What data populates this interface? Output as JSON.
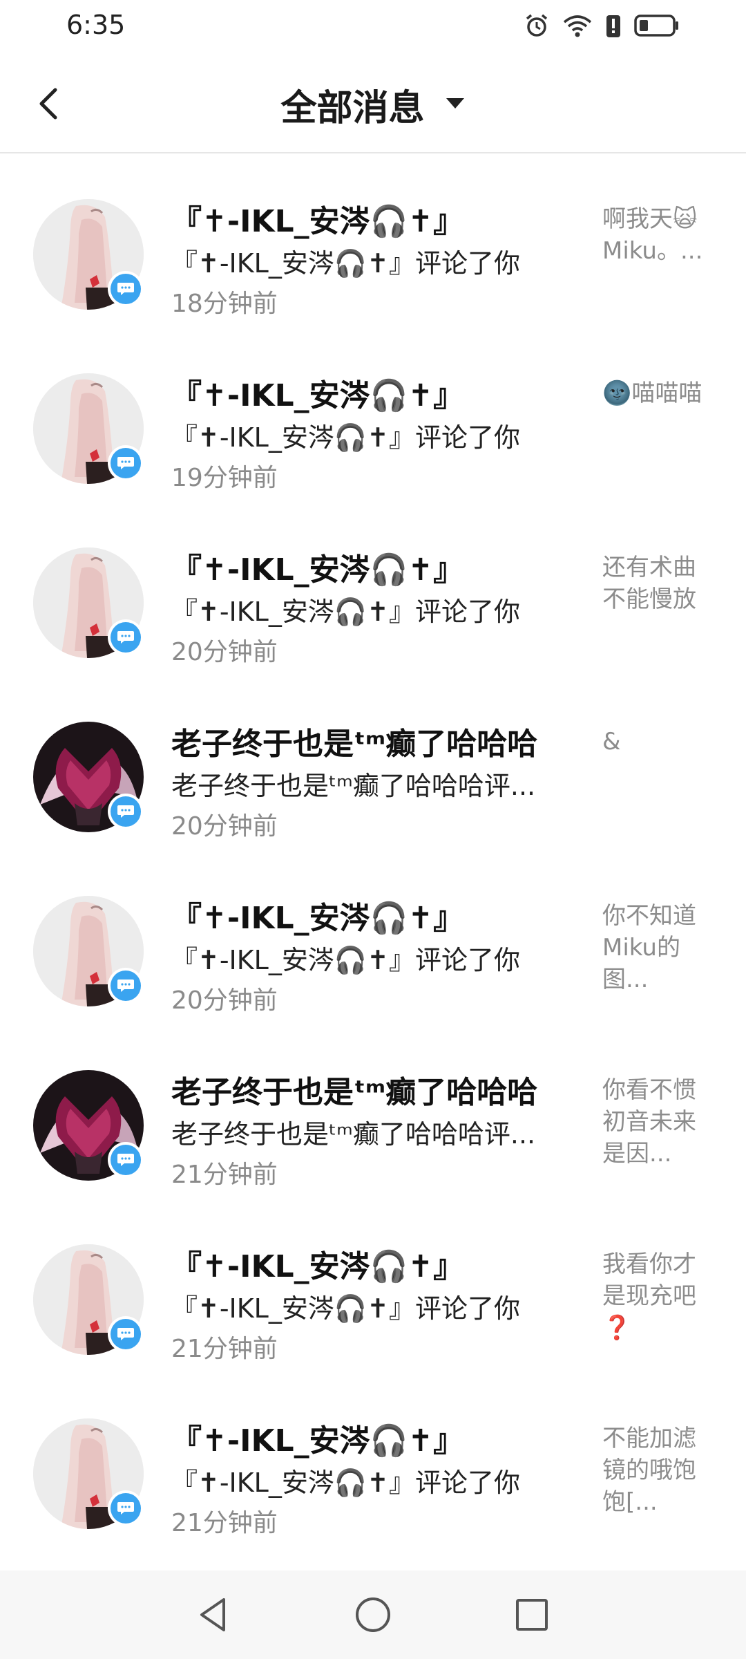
{
  "status_bar": {
    "time": "6:35",
    "icons": [
      "alarm-icon",
      "wifi-icon",
      "battery-alert-icon",
      "battery-icon"
    ]
  },
  "header": {
    "title": "全部消息",
    "back_icon": "chevron-left-icon",
    "dropdown_icon": "caret-down-icon"
  },
  "messages": [
    {
      "name": "『✝-IKL_安涔🎧✝』",
      "action": "『✝-IKL_安涔🎧✝』评论了你",
      "time": "18分钟前",
      "preview": "啊我天🙀 Miku。...",
      "avatar": "pink-hair-avatar"
    },
    {
      "name": "『✝-IKL_安涔🎧✝』",
      "action": "『✝-IKL_安涔🎧✝』评论了你",
      "time": "19分钟前",
      "preview": "🌚喵喵喵",
      "avatar": "pink-hair-avatar"
    },
    {
      "name": "『✝-IKL_安涔🎧✝』",
      "action": "『✝-IKL_安涔🎧✝』评论了你",
      "time": "20分钟前",
      "preview": "还有术曲不能慢放",
      "avatar": "pink-hair-avatar"
    },
    {
      "name": "老子终于也是ᵗᵐ癫了哈哈哈",
      "action": "老子终于也是ᵗᵐ癫了哈哈哈评...",
      "time": "20分钟前",
      "preview": "&",
      "avatar": "heart-mask-avatar"
    },
    {
      "name": "『✝-IKL_安涔🎧✝』",
      "action": "『✝-IKL_安涔🎧✝』评论了你",
      "time": "20分钟前",
      "preview": "你不知道Miku的图...",
      "avatar": "pink-hair-avatar"
    },
    {
      "name": "老子终于也是ᵗᵐ癫了哈哈哈",
      "action": "老子终于也是ᵗᵐ癫了哈哈哈评...",
      "time": "21分钟前",
      "preview": "你看不惯初音未来是因...",
      "avatar": "heart-mask-avatar"
    },
    {
      "name": "『✝-IKL_安涔🎧✝』",
      "action": "『✝-IKL_安涔🎧✝』评论了你",
      "time": "21分钟前",
      "preview": "我看你才是现充吧❓",
      "avatar": "pink-hair-avatar"
    },
    {
      "name": "『✝-IKL_安涔🎧✝』",
      "action": "『✝-IKL_安涔🎧✝』评论了你",
      "time": "21分钟前",
      "preview": "不能加滤镜的哦饱饱[...",
      "avatar": "pink-hair-avatar"
    }
  ],
  "nav_bar": {
    "buttons": [
      "back-triangle-icon",
      "home-circle-icon",
      "recents-square-icon"
    ]
  },
  "colors": {
    "badge": "#3aa4f0",
    "time_text": "#8a8a8a",
    "preview_text": "#8c8c8c"
  }
}
